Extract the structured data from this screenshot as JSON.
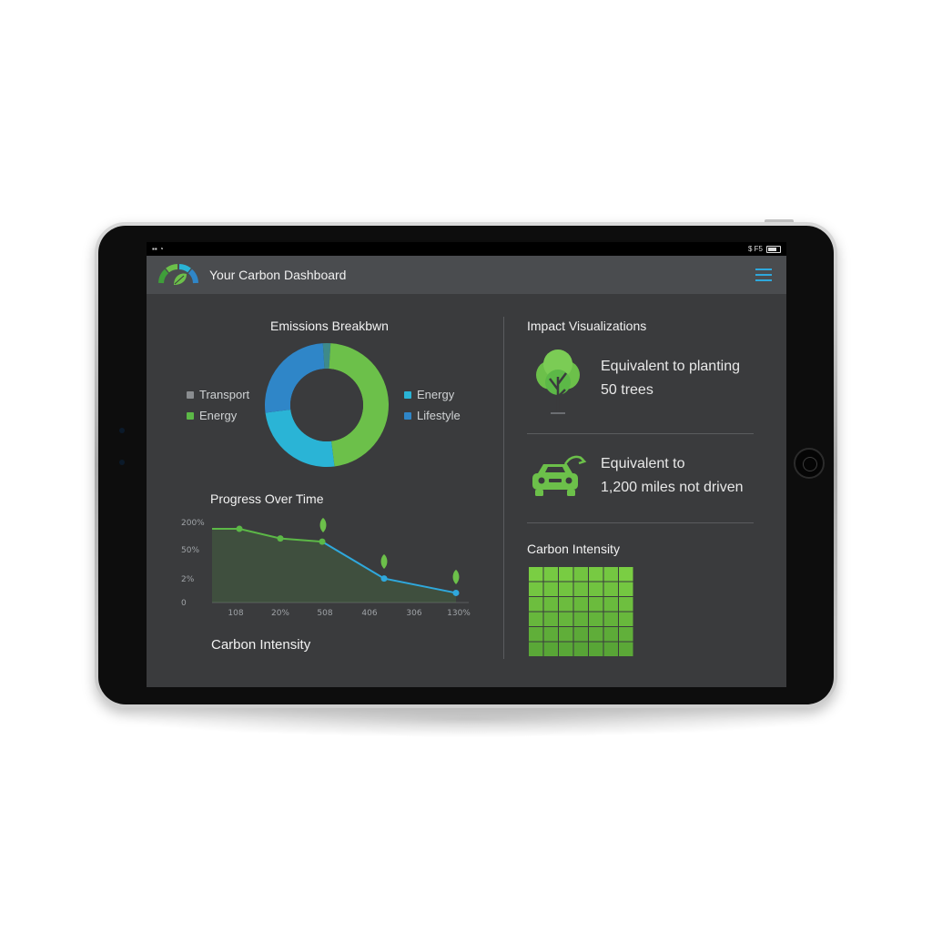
{
  "status": {
    "left": "▪▪ ◔",
    "right": "$ F5"
  },
  "header": {
    "title": "Your Carbon Dashboard",
    "menu_icon": "hamburger-menu-icon"
  },
  "emissions": {
    "title": "Emissions Breakbwn",
    "legend_left": [
      {
        "label": "Transport",
        "color": "#8a8d90"
      },
      {
        "label": "Energy",
        "color": "#5cb847"
      }
    ],
    "legend_right": [
      {
        "label": "Energy",
        "color": "#2ab4d6"
      },
      {
        "label": "Lifestyle",
        "color": "#2f86c8"
      }
    ]
  },
  "progress": {
    "title": "Progress Over Time",
    "footer_label": "Carbon Intensity"
  },
  "impact": {
    "title": "Impact Visualizations",
    "tree": {
      "line1": "Equivalent to planting",
      "line2": "50 trees",
      "icon": "tree-icon"
    },
    "car": {
      "line1": "Equivalent to",
      "line2": "1,200 miles not driven",
      "icon": "car-icon"
    },
    "intensity_title": "Carbon Intensity"
  },
  "colors": {
    "green": "#5cb847",
    "blue": "#2fa8dc",
    "screen_bg": "#3a3b3d"
  },
  "chart_data": [
    {
      "type": "pie",
      "title": "Emissions Breakbwn",
      "labels": [
        "Transport",
        "Energy",
        "Energy",
        "Lifestyle"
      ],
      "values": [
        2,
        47,
        25,
        26
      ],
      "colors": [
        "#3e8a8a",
        "#6cc04a",
        "#2ab4d6",
        "#2f86c8"
      ],
      "donut": true
    },
    {
      "type": "line",
      "title": "Progress Over Time",
      "x": [
        "108",
        "20%",
        "508",
        "406",
        "306",
        "130%"
      ],
      "y_ticks": [
        "200%",
        "50%",
        "2%",
        "0"
      ],
      "series": [
        {
          "values": [
            0.92,
            0.8,
            0.76,
            0.3,
            0.12
          ]
        }
      ]
    },
    {
      "type": "heatmap",
      "title": "Carbon Intensity",
      "rows": 6,
      "cols": 7,
      "values": [
        [
          0.9,
          0.85,
          0.88,
          0.8,
          0.86,
          0.83,
          0.9
        ],
        [
          0.82,
          0.78,
          0.8,
          0.75,
          0.79,
          0.77,
          0.83
        ],
        [
          0.74,
          0.7,
          0.72,
          0.68,
          0.71,
          0.69,
          0.75
        ],
        [
          0.66,
          0.62,
          0.65,
          0.6,
          0.63,
          0.61,
          0.67
        ],
        [
          0.58,
          0.55,
          0.57,
          0.52,
          0.56,
          0.54,
          0.59
        ],
        [
          0.5,
          0.48,
          0.49,
          0.46,
          0.48,
          0.47,
          0.51
        ]
      ]
    }
  ]
}
